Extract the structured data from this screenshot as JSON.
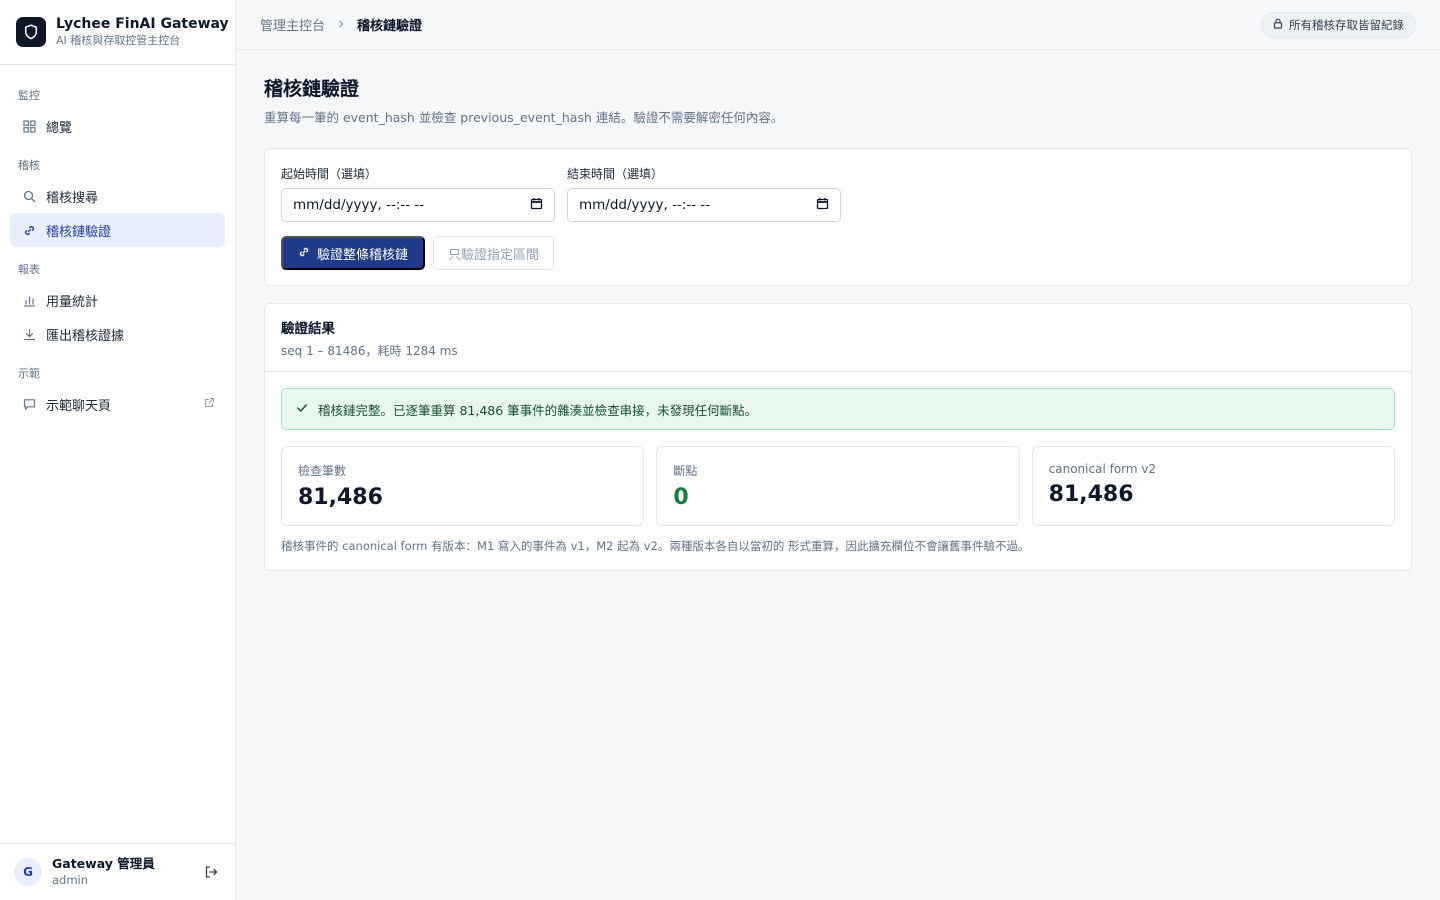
{
  "brand": {
    "title": "Lychee FinAI Gateway",
    "subtitle": "AI 稽核與存取控管主控台"
  },
  "sidebar": {
    "sections": [
      {
        "label": "監控",
        "items": [
          {
            "label": "總覽",
            "icon": "grid-icon"
          }
        ]
      },
      {
        "label": "稽核",
        "items": [
          {
            "label": "稽核搜尋",
            "icon": "search-icon"
          },
          {
            "label": "稽核鏈驗證",
            "icon": "link-icon",
            "active": true
          }
        ]
      },
      {
        "label": "報表",
        "items": [
          {
            "label": "用量統計",
            "icon": "bar-chart-icon"
          },
          {
            "label": "匯出稽核證據",
            "icon": "download-icon"
          }
        ]
      },
      {
        "label": "示範",
        "items": [
          {
            "label": "示範聊天頁",
            "icon": "chat-icon",
            "external": true
          }
        ]
      }
    ]
  },
  "user": {
    "initial": "G",
    "name": "Gateway 管理員",
    "role": "admin"
  },
  "topbar": {
    "breadcrumb_root": "管理主控台",
    "breadcrumb_current": "稽核鏈驗證",
    "pill": "所有稽核存取皆留紀錄"
  },
  "page": {
    "title": "稽核鏈驗證",
    "description": "重算每一筆的 event_hash 並檢查 previous_event_hash 連結。驗證不需要解密任何內容。"
  },
  "filters": {
    "start_label": "起始時間（選填）",
    "start_value": "mm/dd/yyyy, --:-- --",
    "end_label": "結束時間（選填）",
    "end_value": "mm/dd/yyyy, --:-- --",
    "verify_all_label": "驗證整條稽核鏈",
    "verify_range_label": "只驗證指定區間"
  },
  "result": {
    "title": "驗證結果",
    "subtitle": "seq 1 – 81486，耗時 1284 ms",
    "alert": "稽核鏈完整。已逐筆重算 81,486 筆事件的雜湊並檢查串接，未發現任何斷點。",
    "stats": [
      {
        "label": "檢查筆數",
        "value": "81,486"
      },
      {
        "label": "斷點",
        "value": "0"
      },
      {
        "label": "canonical form v2",
        "value": "81,486"
      }
    ],
    "note": "稽核事件的 canonical form 有版本：M1 寫入的事件為 v1，M2 起為 v2。兩種版本各自以當初的 形式重算，因此擴充欄位不會讓舊事件驗不過。"
  },
  "colors": {
    "accent": "#1e3a8a",
    "active_bg": "#e8eefc",
    "success_bg": "#e9f8ef",
    "success_text": "#15803d"
  }
}
